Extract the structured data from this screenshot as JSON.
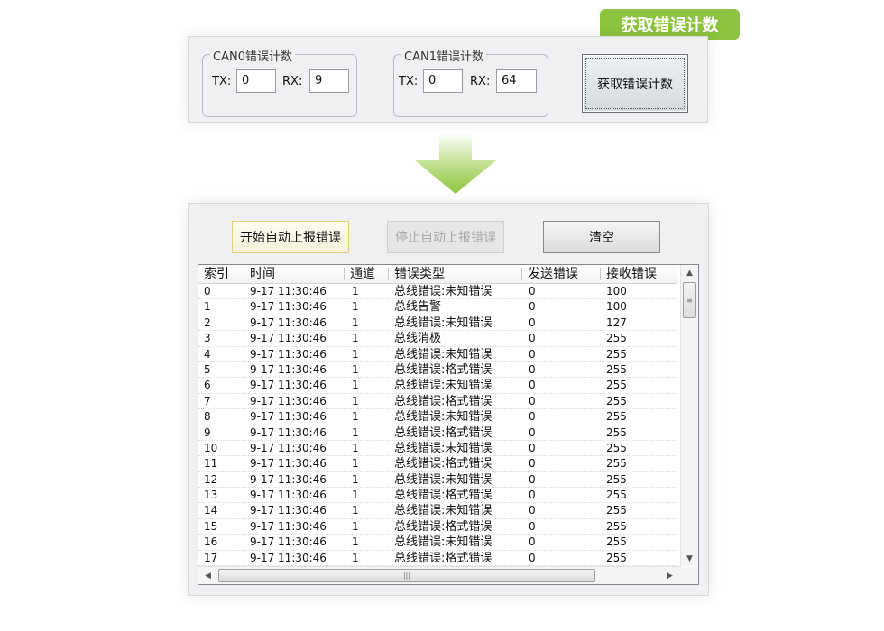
{
  "callout": {
    "text": "获取错误计数"
  },
  "counter_panel": {
    "can0": {
      "title": "CAN0错误计数",
      "tx_label": "TX:",
      "tx_value": "0",
      "rx_label": "RX:",
      "rx_value": "9"
    },
    "can1": {
      "title": "CAN1错误计数",
      "tx_label": "TX:",
      "tx_value": "0",
      "rx_label": "RX:",
      "rx_value": "64"
    },
    "get_button": "获取错误计数"
  },
  "report_panel": {
    "start_button": "开始自动上报错误",
    "stop_button": "停止自动上报错误",
    "clear_button": "清空",
    "columns": [
      "索引",
      "时间",
      "通道",
      "错误类型",
      "发送错误",
      "接收错误"
    ],
    "rows": [
      [
        "0",
        "9-17 11:30:46",
        "1",
        "总线错误:未知错误",
        "0",
        "100"
      ],
      [
        "1",
        "9-17 11:30:46",
        "1",
        "总线告警",
        "0",
        "100"
      ],
      [
        "2",
        "9-17 11:30:46",
        "1",
        "总线错误:未知错误",
        "0",
        "127"
      ],
      [
        "3",
        "9-17 11:30:46",
        "1",
        "总线消极",
        "0",
        "255"
      ],
      [
        "4",
        "9-17 11:30:46",
        "1",
        "总线错误:未知错误",
        "0",
        "255"
      ],
      [
        "5",
        "9-17 11:30:46",
        "1",
        "总线错误:格式错误",
        "0",
        "255"
      ],
      [
        "6",
        "9-17 11:30:46",
        "1",
        "总线错误:未知错误",
        "0",
        "255"
      ],
      [
        "7",
        "9-17 11:30:46",
        "1",
        "总线错误:格式错误",
        "0",
        "255"
      ],
      [
        "8",
        "9-17 11:30:46",
        "1",
        "总线错误:未知错误",
        "0",
        "255"
      ],
      [
        "9",
        "9-17 11:30:46",
        "1",
        "总线错误:格式错误",
        "0",
        "255"
      ],
      [
        "10",
        "9-17 11:30:46",
        "1",
        "总线错误:未知错误",
        "0",
        "255"
      ],
      [
        "11",
        "9-17 11:30:46",
        "1",
        "总线错误:格式错误",
        "0",
        "255"
      ],
      [
        "12",
        "9-17 11:30:46",
        "1",
        "总线错误:未知错误",
        "0",
        "255"
      ],
      [
        "13",
        "9-17 11:30:46",
        "1",
        "总线错误:格式错误",
        "0",
        "255"
      ],
      [
        "14",
        "9-17 11:30:46",
        "1",
        "总线错误:未知错误",
        "0",
        "255"
      ],
      [
        "15",
        "9-17 11:30:46",
        "1",
        "总线错误:格式错误",
        "0",
        "255"
      ],
      [
        "16",
        "9-17 11:30:46",
        "1",
        "总线错误:未知错误",
        "0",
        "255"
      ],
      [
        "17",
        "9-17 11:30:46",
        "1",
        "总线错误:格式错误",
        "0",
        "255"
      ]
    ]
  },
  "colors": {
    "accent": "#8cc43f",
    "start_border": "#e8d58a"
  }
}
